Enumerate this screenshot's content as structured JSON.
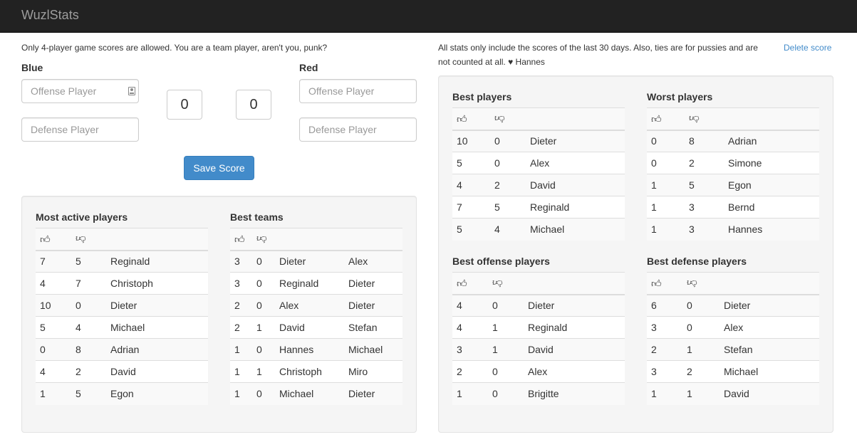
{
  "app": {
    "title": "WuzlStats"
  },
  "form": {
    "note": "Only 4-player game scores are allowed. You are a team player, aren't you, punk?",
    "blue_label": "Blue",
    "red_label": "Red",
    "offense_placeholder": "Offense Player",
    "defense_placeholder": "Defense Player",
    "blue_score": "0",
    "red_score": "0",
    "save_label": "Save Score"
  },
  "stats_note": "All stats only include the scores of the last 30 days. Also, ties are for pussies and are not counted at all. ♥ Hannes",
  "delete_label": "Delete score",
  "icons": {
    "win": "thumbs-up-icon",
    "loss": "thumbs-down-icon"
  },
  "colors": {
    "navbar": "#222222",
    "primary": "#428bca",
    "link": "#428bca"
  },
  "most_active": {
    "title": "Most active players",
    "rows": [
      {
        "w": "7",
        "l": "5",
        "name": "Reginald"
      },
      {
        "w": "4",
        "l": "7",
        "name": "Christoph"
      },
      {
        "w": "10",
        "l": "0",
        "name": "Dieter"
      },
      {
        "w": "5",
        "l": "4",
        "name": "Michael"
      },
      {
        "w": "0",
        "l": "8",
        "name": "Adrian"
      },
      {
        "w": "4",
        "l": "2",
        "name": "David"
      },
      {
        "w": "1",
        "l": "5",
        "name": "Egon"
      }
    ]
  },
  "best_teams": {
    "title": "Best teams",
    "rows": [
      {
        "w": "3",
        "l": "0",
        "p1": "Dieter",
        "p2": "Alex"
      },
      {
        "w": "3",
        "l": "0",
        "p1": "Reginald",
        "p2": "Dieter"
      },
      {
        "w": "2",
        "l": "0",
        "p1": "Alex",
        "p2": "Dieter"
      },
      {
        "w": "2",
        "l": "1",
        "p1": "David",
        "p2": "Stefan"
      },
      {
        "w": "1",
        "l": "0",
        "p1": "Hannes",
        "p2": "Michael"
      },
      {
        "w": "1",
        "l": "1",
        "p1": "Christoph",
        "p2": "Miro"
      },
      {
        "w": "1",
        "l": "0",
        "p1": "Michael",
        "p2": "Dieter"
      }
    ]
  },
  "best_players": {
    "title": "Best players",
    "rows": [
      {
        "w": "10",
        "l": "0",
        "name": "Dieter"
      },
      {
        "w": "5",
        "l": "0",
        "name": "Alex"
      },
      {
        "w": "4",
        "l": "2",
        "name": "David"
      },
      {
        "w": "7",
        "l": "5",
        "name": "Reginald"
      },
      {
        "w": "5",
        "l": "4",
        "name": "Michael"
      }
    ]
  },
  "worst_players": {
    "title": "Worst players",
    "rows": [
      {
        "w": "0",
        "l": "8",
        "name": "Adrian"
      },
      {
        "w": "0",
        "l": "2",
        "name": "Simone"
      },
      {
        "w": "1",
        "l": "5",
        "name": "Egon"
      },
      {
        "w": "1",
        "l": "3",
        "name": "Bernd"
      },
      {
        "w": "1",
        "l": "3",
        "name": "Hannes"
      }
    ]
  },
  "best_offense": {
    "title": "Best offense players",
    "rows": [
      {
        "w": "4",
        "l": "0",
        "name": "Dieter"
      },
      {
        "w": "4",
        "l": "1",
        "name": "Reginald"
      },
      {
        "w": "3",
        "l": "1",
        "name": "David"
      },
      {
        "w": "2",
        "l": "0",
        "name": "Alex"
      },
      {
        "w": "1",
        "l": "0",
        "name": "Brigitte"
      }
    ]
  },
  "best_defense": {
    "title": "Best defense players",
    "rows": [
      {
        "w": "6",
        "l": "0",
        "name": "Dieter"
      },
      {
        "w": "3",
        "l": "0",
        "name": "Alex"
      },
      {
        "w": "2",
        "l": "1",
        "name": "Stefan"
      },
      {
        "w": "3",
        "l": "2",
        "name": "Michael"
      },
      {
        "w": "1",
        "l": "1",
        "name": "David"
      }
    ]
  }
}
